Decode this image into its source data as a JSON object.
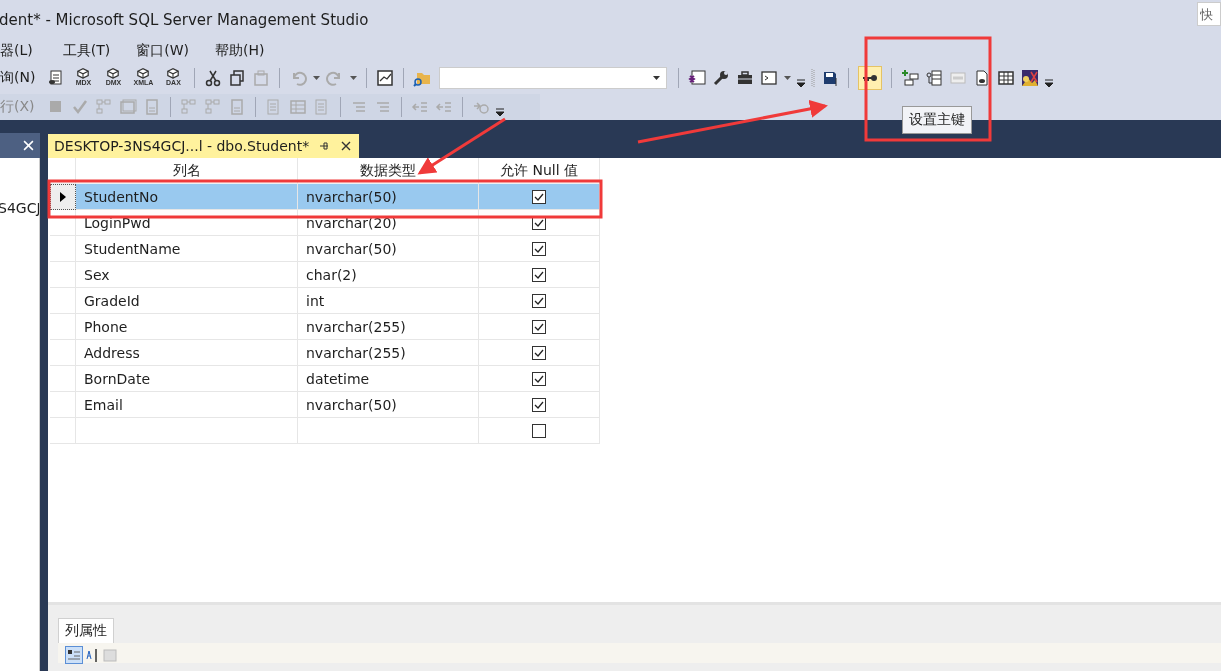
{
  "window": {
    "title": "dent* - Microsoft SQL Server Management Studio",
    "quick_launch": {
      "placeholder": "快"
    }
  },
  "menu": [
    "器(L)",
    "工具(T)",
    "窗口(W)",
    "帮助(H)"
  ],
  "toolbar_1": {
    "label": "询(N)",
    "query_icons": [
      "MDX",
      "DMX",
      "XMLA",
      "DAX"
    ],
    "key_button": {
      "selected": true
    },
    "tooltip": "设置主键"
  },
  "toolbar_2": {
    "label": "行(X)",
    "disabled": true
  },
  "left_panel": {
    "text": "S4GCJ"
  },
  "document_tab": {
    "title": "DESKTOP-3NS4GCJ...l - dbo.Student*",
    "selected": true
  },
  "table": {
    "columns": [
      "列名",
      "数据类型",
      "允许 Null 值"
    ],
    "rows": [
      {
        "kind": "column",
        "name": "StudentNo",
        "type": "nvarchar(50)",
        "allow_null": true,
        "selected": true
      },
      {
        "kind": "column",
        "name": "LoginPwd",
        "type": "nvarchar(20)",
        "allow_null": true,
        "selected": false
      },
      {
        "kind": "column",
        "name": "StudentName",
        "type": "nvarchar(50)",
        "allow_null": true,
        "selected": false
      },
      {
        "kind": "column",
        "name": "Sex",
        "type": "char(2)",
        "allow_null": true,
        "selected": false
      },
      {
        "kind": "column",
        "name": "GradeId",
        "type": "int",
        "allow_null": true,
        "selected": false
      },
      {
        "kind": "column",
        "name": "Phone",
        "type": "nvarchar(255)",
        "allow_null": true,
        "selected": false
      },
      {
        "kind": "column",
        "name": "Address",
        "type": "nvarchar(255)",
        "allow_null": true,
        "selected": false
      },
      {
        "kind": "column",
        "name": "BornDate",
        "type": "datetime",
        "allow_null": true,
        "selected": false
      },
      {
        "kind": "column",
        "name": "Email",
        "type": "nvarchar(50)",
        "allow_null": true,
        "selected": false
      },
      {
        "kind": "new",
        "allow_null": false,
        "selected": false
      }
    ]
  },
  "properties": {
    "tab": "列属性"
  }
}
